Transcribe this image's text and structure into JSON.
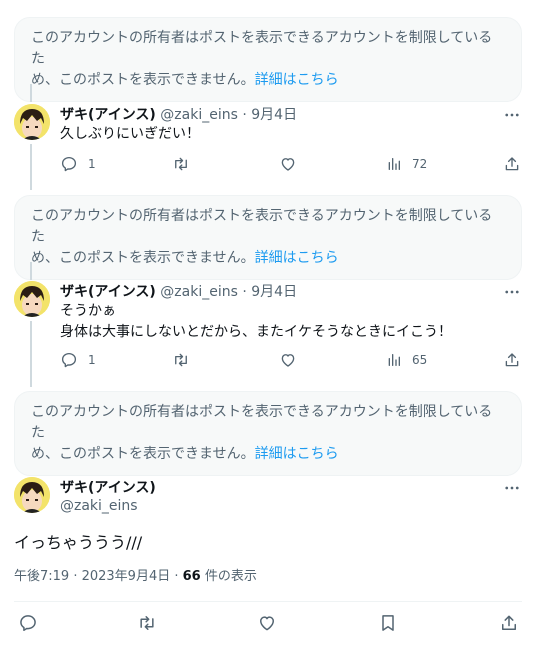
{
  "notice": {
    "line1": "このアカウントの所有者はポストを表示できるアカウントを制限しているた",
    "line2": "め、このポストを表示できません。",
    "link": "詳細はこちら"
  },
  "user": {
    "name": "ザキ(アインス)",
    "handle": "@zaki_eins"
  },
  "replies": [
    {
      "date": "9月4日",
      "text_lines": [
        "久しぶりにいぎだい！"
      ],
      "reply_count": "1",
      "views": "72"
    },
    {
      "date": "9月4日",
      "text_lines": [
        "そうかぁ",
        "身体は大事にしないとだから、またイケそうなときにイこう！"
      ],
      "reply_count": "1",
      "views": "65"
    }
  ],
  "separator": "·",
  "main_post": {
    "text": "イっちゃううう///",
    "time": "午後7:19 · 2023年9月4日 · ",
    "views_count": "66",
    "views_label": " 件の表示"
  },
  "icons": {
    "reply": "reply-icon",
    "repost": "repost-icon",
    "like": "heart-icon",
    "views": "views-icon",
    "share": "share-icon",
    "bookmark": "bookmark-icon",
    "more": "more-icon"
  },
  "colors": {
    "link": "#1d9bf0",
    "secondary_text": "#536471",
    "notice_bg": "#f7f9f9"
  }
}
